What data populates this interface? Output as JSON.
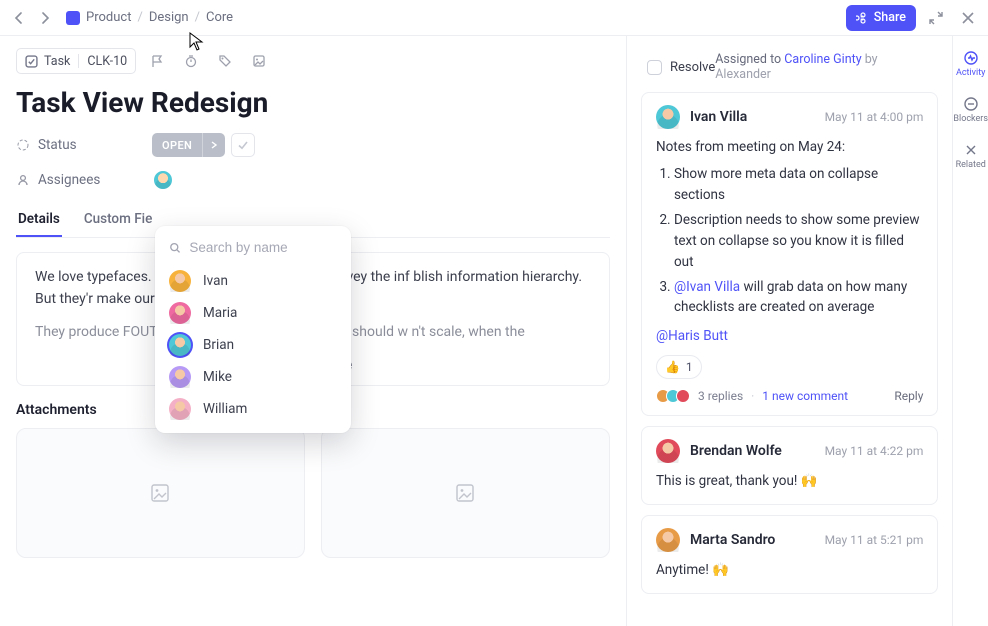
{
  "breadcrumbs": [
    "Product",
    "Design",
    "Core"
  ],
  "share_label": "Share",
  "chip": {
    "type": "Task",
    "id": "CLK-10"
  },
  "title": "Task View Redesign",
  "labels": {
    "status": "Status",
    "assignees": "Assignees"
  },
  "status_value": "OPEN",
  "tabs": [
    {
      "label": "Details",
      "active": true
    },
    {
      "label": "Custom Fie",
      "active": false
    }
  ],
  "description": {
    "p1": "We love typefaces. T                                         s personalized feel. They convey the inf                                         blish information hierarchy. But they'r                                         make our websites slow.",
    "p2": "They produce FOUT                                          ler in unpredictable ways. Why should w                                        n't scale, when the",
    "show_more": "Show more"
  },
  "attachments_heading": "Attachments",
  "assignee_popover": {
    "placeholder": "Search by name",
    "options": [
      {
        "name": "Ivan",
        "color": "#f7b23b"
      },
      {
        "name": "Maria",
        "color": "#ee6aa0"
      },
      {
        "name": "Brian",
        "color": "#4ec7d6",
        "selected": true
      },
      {
        "name": "Mike",
        "color": "#b79af5"
      },
      {
        "name": "William",
        "color": "#f4b0c6"
      }
    ]
  },
  "panel": {
    "resolve": "Resolve",
    "assigned_prefix": "Assigned to ",
    "assigned_name": "Caroline Ginty",
    "assigned_by": " by Alexander"
  },
  "comments": [
    {
      "avatar_color": "#4ec7d6",
      "name": "Ivan Villa",
      "time": "May 11 at 4:00 pm",
      "lead": "Notes from meeting on May 24:",
      "list": [
        "Show more meta data on collapse sections",
        "Description needs to show some preview text on collapse so you know it is filled out"
      ],
      "list3_a": "@Ivan Villa",
      "list3_b": " will grab data on how many checklists are created on average",
      "mention": "@Haris Butt",
      "reaction": {
        "emoji": "👍",
        "count": "1"
      },
      "replies_count": "3 replies",
      "new_comment": "1 new comment",
      "reply_label": "Reply"
    },
    {
      "avatar_color": "#e14a5a",
      "name": "Brendan Wolfe",
      "time": "May 11 at 4:22 pm",
      "body": "This is great, thank you! 🙌"
    },
    {
      "avatar_color": "#e89b46",
      "name": "Marta Sandro",
      "time": "May 11 at 5:21 pm",
      "body": "Anytime! 🙌"
    }
  ],
  "rail": [
    {
      "label": "Activity",
      "icon": "activity",
      "active": true
    },
    {
      "label": "Blockers",
      "icon": "blockers",
      "active": false
    },
    {
      "label": "Related",
      "icon": "related",
      "active": false
    }
  ]
}
